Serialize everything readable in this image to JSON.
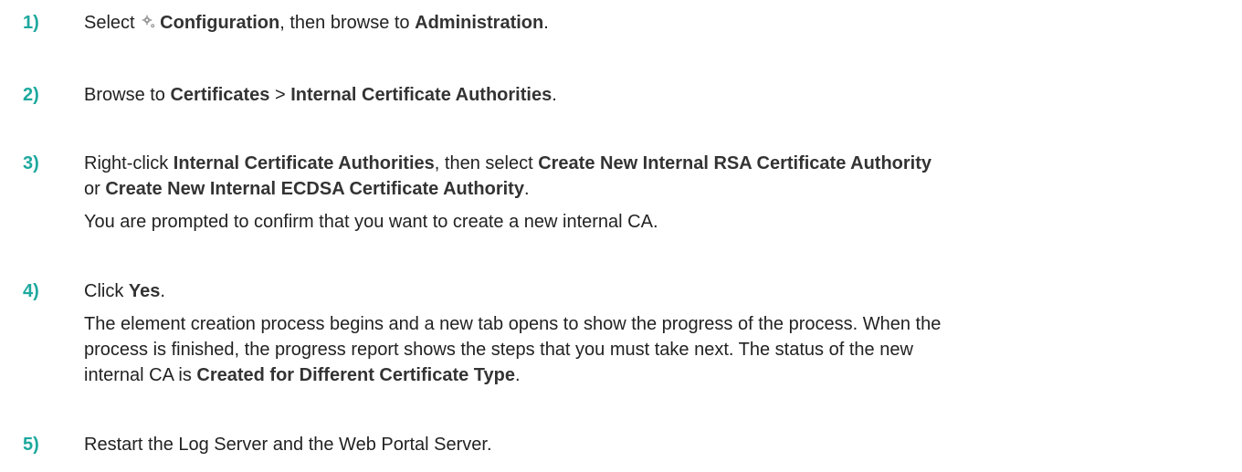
{
  "steps": [
    {
      "number": "1)",
      "lines": [
        {
          "t1": "Select ",
          "icon": "gear-icon",
          "b1": "Configuration",
          "t2": ", then browse to ",
          "b2": "Administration",
          "t3": "."
        }
      ]
    },
    {
      "number": "2)",
      "lines": [
        {
          "t1": "Browse to ",
          "b1": "Certificates",
          "t2": " > ",
          "b2": "Internal Certificate Authorities",
          "t3": "."
        }
      ]
    },
    {
      "number": "3)",
      "lines": [
        {
          "t1": "Right-click ",
          "b1": "Internal Certificate Authorities",
          "t2": ", then select ",
          "b2": "Create New Internal RSA Certificate Authority"
        },
        {
          "t1": "or ",
          "b1": "Create New Internal ECDSA Certificate Authority",
          "t2": "."
        },
        {
          "t1": "You are prompted to confirm that you want to create a new internal CA."
        }
      ]
    },
    {
      "number": "4)",
      "lines": [
        {
          "t1": "Click ",
          "b1": "Yes",
          "t2": "."
        },
        {
          "t1": "The element creation process begins and a new tab opens to show the progress of the process. When the"
        },
        {
          "t1": "process is finished, the progress report shows the steps that you must take next. The status of the new"
        },
        {
          "t1": "internal CA is ",
          "b1": "Created for Different Certificate Type",
          "t2": "."
        }
      ]
    },
    {
      "number": "5)",
      "lines": [
        {
          "t1": "Restart the Log Server and the Web Portal Server."
        }
      ]
    }
  ]
}
